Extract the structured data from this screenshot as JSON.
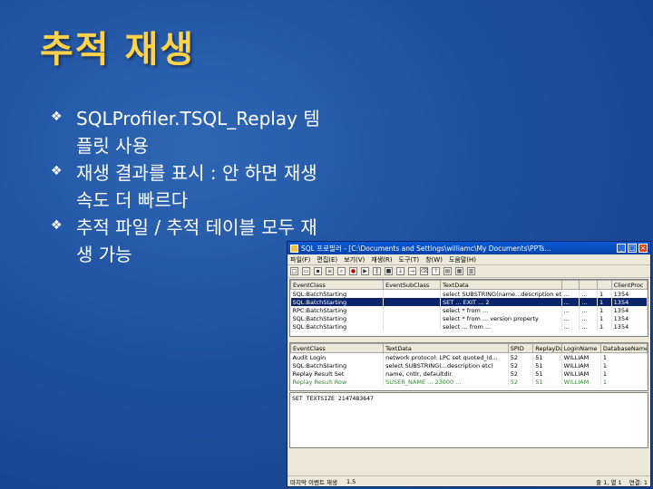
{
  "slide": {
    "title": "추적 재생",
    "bullets": [
      "SQLProfiler.TSQL_Replay 템플릿 사용",
      "재생 결과를 표시 : 안 하면 재생 속도 더 빠르다",
      "추적 파일 / 추적 테이블 모두 재생 가능"
    ]
  },
  "window": {
    "title": "SQL 프로필러 - [C:\\Documents and Settings\\williamc\\My Documents\\PPTs...",
    "menus": [
      "파일(F)",
      "편집(E)",
      "보기(V)",
      "재생(R)",
      "도구(T)",
      "창(W)",
      "도움말(H)"
    ],
    "top_grid": {
      "columns": [
        "EventClass",
        "EventSubClass",
        "TextData",
        "",
        "",
        "",
        "ClientProc"
      ],
      "rows": [
        [
          "SQL:BatchStarting",
          "",
          "select SUBSTRING(name...description etc)",
          "...",
          "...",
          "1",
          "1354"
        ],
        [
          "SQL:BatchStarting",
          "",
          "SET ... EXIT ... 2",
          "...",
          "...",
          "1",
          "1354"
        ],
        [
          "RPC:BatchStarting",
          "",
          "select * from ...",
          "...",
          "...",
          "1",
          "1354"
        ],
        [
          "SQL:BatchStarting",
          "",
          "select * from ... version property",
          "...",
          "...",
          "1",
          "1354"
        ],
        [
          "SQL:BatchStarting",
          "",
          "select ... from ...",
          "...",
          "...",
          "1",
          "1354"
        ]
      ]
    },
    "bottom_grid": {
      "columns": [
        "EventClass",
        "TextData",
        "SPID",
        "ReplayData",
        "LoginName",
        "DatabaseName"
      ],
      "rows": [
        [
          "Audit Login",
          "network protocol: LPC set quoted_id...",
          "52",
          "51",
          "WILLIAM",
          "1"
        ],
        [
          "SQL:BatchStarting",
          "select SUBSTRING(...description etc)",
          "52",
          "51",
          "WILLIAM",
          "1"
        ],
        [
          "Replay Result Set",
          "name, cntlr, defaultdir",
          "52",
          "51",
          "WILLIAM",
          "1"
        ],
        [
          "Replay Result Row",
          "SUSER_NAME ... 23000 ...",
          "52",
          "51",
          "WILLIAM",
          "1"
        ]
      ]
    },
    "text_pane": "SET TEXTSIZE 2147483647",
    "status": {
      "left": "마지막 이벤트 재생",
      "middle": "1.5",
      "right": "줄 1, 열 1",
      "connections": "연결: 1"
    }
  }
}
